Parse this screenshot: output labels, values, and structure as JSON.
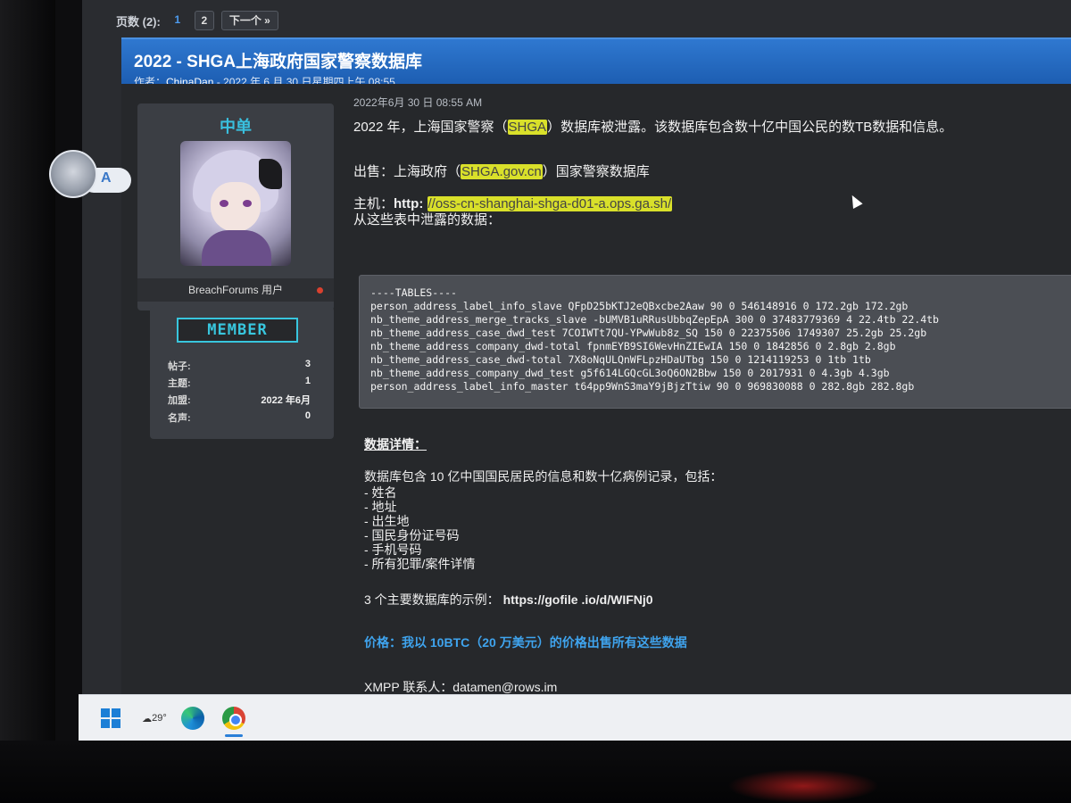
{
  "pager": {
    "label": "页数 (2):",
    "pages": [
      "1",
      "2"
    ],
    "next": "下一个 »"
  },
  "thread": {
    "title": "2022 - SHGA上海政府国家警察数据库",
    "meta_prefix": "作者：",
    "author": "ChinaDan",
    "meta_suffix": " - 2022 年 6 月 30 日星期四上午 08:55"
  },
  "user": {
    "name": "中单",
    "role": "BreachForums 用户",
    "badge": "MEMBER",
    "stats": [
      {
        "label": "帖子:",
        "value": "3"
      },
      {
        "label": "主题:",
        "value": "1"
      },
      {
        "label": "加盟:",
        "value": "2022 年6月"
      },
      {
        "label": "名声:",
        "value": "0"
      }
    ]
  },
  "post": {
    "date": "2022年6月 30 日 08:55  AM",
    "intro_before": "2022 年，上海国家警察（",
    "intro_hl": "SHGA",
    "intro_after": "）数据库被泄露。该数据库包含数十亿中国公民的数TB数据和信息。",
    "sale_before": "出售：上海政府（",
    "sale_hl": "SHGA.gov.cn",
    "sale_after": "）国家警察数据库",
    "host_label": "主机：",
    "host_prefix": "http: ",
    "host_hl": "//oss-cn-shanghai-shga-d01-a.ops.ga.sh/",
    "leak_line": "从这些表中泄露的数据：",
    "code": "----TABLES----\nperson_address_label_info_slave QFpD25bKTJ2eQBxcbe2Aaw 90 0 546148916 0 172.2gb 172.2gb\nnb_theme_address_merge_tracks_slave -bUMVB1uRRusUbbqZepEpA 300 0 37483779369 4 22.4tb 22.4tb\nnb_theme_address_case_dwd_test 7COIWTt7QU-YPwWub8z_SQ 150 0 22375506 1749307 25.2gb 25.2gb\nnb_theme_address_company_dwd-total fpnmEYB9SI6WevHnZIEwIA 150 0 1842856 0 2.8gb 2.8gb\nnb_theme_address_case_dwd-total 7X8oNqULQnWFLpzHDaUTbg 150 0 1214119253 0 1tb 1tb\nnb_theme_address_company_dwd_test g5f614LGQcGL3oQ6ON2Bbw 150 0 2017931 0 4.3gb 4.3gb\nperson_address_label_info_master t64pp9WnS3maY9jBjzTtiw 90 0 969830088 0 282.8gb 282.8gb",
    "details_title": "数据详情：",
    "details_intro": "数据库包含 10 亿中国国民居民的信息和数十亿病例记录，包括：",
    "fields": [
      "- 姓名",
      "- 地址",
      "- 出生地",
      "- 国民身份证号码",
      "- 手机号码",
      "- 所有犯罪/案件详情"
    ],
    "sample_label": "3 个主要数据库的示例：",
    "sample_link": "https://gofile .io/d/WIFNj0",
    "price": "价格：我以 10BTC（20 万美元）的价格出售所有这些数据",
    "xmpp": "XMPP 联系人：datamen@rows.im"
  },
  "chat": {
    "letter": "A"
  },
  "taskbar": {
    "temperature": "29°"
  },
  "colors": {
    "header_blue": "#2a6fc4",
    "accent_cyan": "#38c6de",
    "highlight": "#d9e02a",
    "price_blue": "#3fa4ee"
  }
}
